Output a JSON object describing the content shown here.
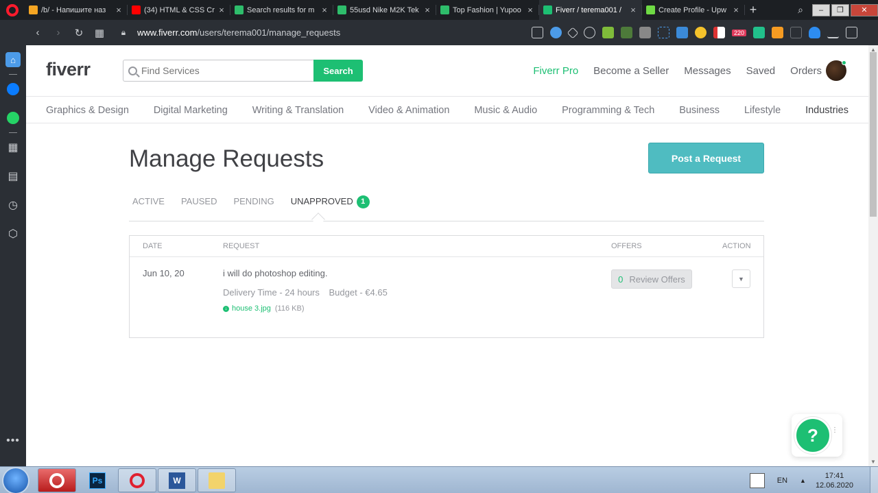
{
  "browser": {
    "tabs": [
      {
        "title": "/b/ - Напишите наз",
        "fav": "#f5a623"
      },
      {
        "title": "(34) HTML & CSS Cr",
        "fav": "#ff0000"
      },
      {
        "title": "Search results for m",
        "fav": "#2ebd6b"
      },
      {
        "title": "55usd Nike M2K Tek",
        "fav": "#2ebd6b"
      },
      {
        "title": "Top Fashion | Yupoo",
        "fav": "#2ebd6b"
      },
      {
        "title": "Fiverr / terema001 /",
        "fav": "#1dbf73",
        "active": true
      },
      {
        "title": "Create Profile - Upw",
        "fav": "#6fda44"
      }
    ],
    "close_glyph": "×",
    "new_tab_glyph": "+",
    "url_host": "www.fiverr.com",
    "url_path": "/users/terema001/manage_requests",
    "ext_badge": "220"
  },
  "header": {
    "logo": "fiverr",
    "search_placeholder": "Find Services",
    "search_button": "Search",
    "nav": [
      "Fiverr Pro",
      "Become a Seller",
      "Messages",
      "Saved",
      "Orders"
    ]
  },
  "categories": [
    "Graphics & Design",
    "Digital Marketing",
    "Writing & Translation",
    "Video & Animation",
    "Music & Audio",
    "Programming & Tech",
    "Business",
    "Lifestyle",
    "Industries"
  ],
  "main": {
    "title": "Manage Requests",
    "post_button": "Post a Request",
    "tabs": {
      "active": "ACTIVE",
      "paused": "PAUSED",
      "pending": "PENDING",
      "unapproved": "UNAPPROVED",
      "unapproved_count": "1"
    },
    "table": {
      "headers": {
        "date": "DATE",
        "request": "REQUEST",
        "offers": "OFFERS",
        "action": "ACTION"
      },
      "row": {
        "date": "Jun 10, 20",
        "request": "i will do photoshop editing.",
        "delivery": "Delivery Time - 24 hours",
        "budget": "Budget - €4.65",
        "attachment_name": "house 3.jpg",
        "attachment_size": "(116 KB)",
        "offers_count": "0",
        "review_label": "Review Offers",
        "action_glyph": "▼"
      }
    }
  },
  "help": {
    "glyph": "?"
  },
  "taskbar": {
    "lang": "EN",
    "time": "17:41",
    "date": "12.06.2020",
    "ps_label": "Ps",
    "word_label": "W"
  },
  "colors": {
    "brand_green": "#1dbf73",
    "post_request": "#4fbcc1"
  }
}
